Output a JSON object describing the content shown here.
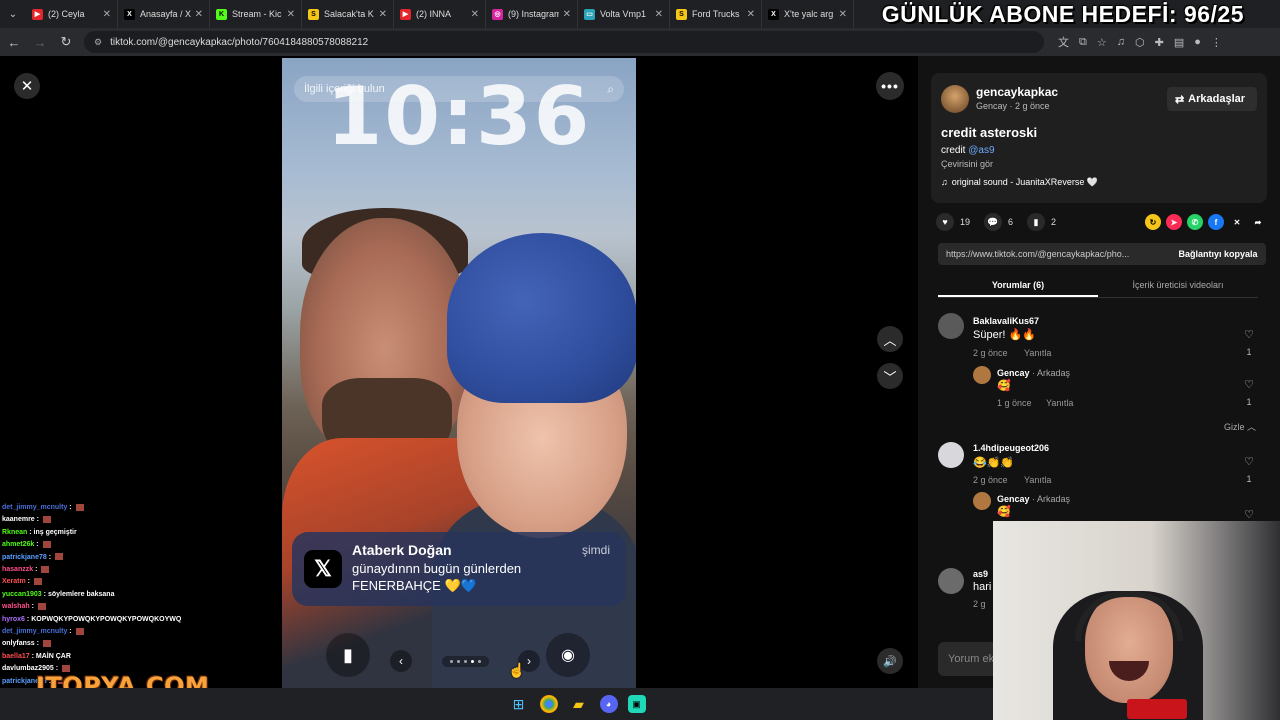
{
  "browser": {
    "tabs": [
      {
        "label": "(2) Ceyla",
        "favicon": "youtube-icon",
        "color": "#e5252a"
      },
      {
        "label": "Anasayfa / X",
        "favicon": "x-icon",
        "color": "#000000"
      },
      {
        "label": "Stream - Kic",
        "favicon": "kick-icon",
        "color": "#53fc18"
      },
      {
        "label": "Salacak'ta K",
        "favicon": "s-icon",
        "color": "#f5c518"
      },
      {
        "label": "(2) INNA",
        "favicon": "youtube-icon",
        "color": "#e5252a"
      },
      {
        "label": "(9) Instagram",
        "favicon": "instagram-icon",
        "color": "#d6249f"
      },
      {
        "label": "Volta Vmp1",
        "favicon": "volta-icon",
        "color": "#2aa4b8"
      },
      {
        "label": "Ford Trucks",
        "favicon": "s-icon",
        "color": "#f5c518"
      },
      {
        "label": "X'te yalc arg",
        "favicon": "x-icon",
        "color": "#000000"
      }
    ],
    "overlay_goal": "GÜNLÜK ABONE HEDEFİ: 96/25",
    "url": "tiktok.com/@gencaykapkac/photo/7604184880578088212"
  },
  "viewer": {
    "lockscreen": {
      "search_placeholder": "İlgili içeriği bulun",
      "time": "10:36",
      "notification": {
        "sender": "Ataberk Doğan",
        "time": "şimdi",
        "line1": "günaydınnn bugün günlerden",
        "line2": "FENERBAHÇE 💛💙"
      }
    },
    "pager": {
      "dots": 5,
      "active_index": 3
    }
  },
  "chat": [
    {
      "user": "det_jimmy_mcnulty",
      "msg": "",
      "color": "#4a6fd8"
    },
    {
      "user": "kaanemre",
      "msg": "",
      "color": "#ffffff"
    },
    {
      "user": "Rknean",
      "msg": "inş geçmiştir",
      "color": "#53fc18"
    },
    {
      "user": "ahmet26k",
      "msg": "",
      "color": "#53fc18"
    },
    {
      "user": "patrickjane78",
      "msg": "",
      "color": "#5aa0ff"
    },
    {
      "user": "hasanzzk",
      "msg": "",
      "color": "#ff4f8b"
    },
    {
      "user": "Xeratm",
      "msg": "",
      "color": "#ff4f4f"
    },
    {
      "user": "yuccan1903",
      "msg": "söylemlere baksana",
      "color": "#53fc18"
    },
    {
      "user": "walshah",
      "msg": "",
      "color": "#ff4f8b"
    },
    {
      "user": "hyrox6",
      "msg": "KOPWQKYPOWQKYPOWQKYPOWQKOYWQ",
      "color": "#b070ff"
    },
    {
      "user": "det_jimmy_mcnulty",
      "msg": "",
      "color": "#4a6fd8"
    },
    {
      "user": "onlyfanss",
      "msg": "",
      "color": "#ffffff"
    },
    {
      "user": "baella17",
      "msg": "MAİN ÇAR",
      "color": "#ff4f4f"
    },
    {
      "user": "davlumbaz2905",
      "msg": "",
      "color": "#ffffff"
    },
    {
      "user": "patrickjane78",
      "msg": "",
      "color": "#5aa0ff"
    }
  ],
  "watermark": "ITOPYA.COM",
  "panel": {
    "author": {
      "username": "gencaykapkac",
      "meta": "Gencay · 2 g önce",
      "friends_label": "Arkadaşlar",
      "title": "credit asteroski",
      "credit_prefix": "credit ",
      "credit_mention": "@as9",
      "translate": "Çevirisini gör",
      "sound": "original sound - JuanitaXReverse 🤍"
    },
    "stats": {
      "likes": "19",
      "comments": "6",
      "saves": "2"
    },
    "link_text": "https://www.tiktok.com/@gencaykapkac/pho...",
    "copy_label": "Bağlantıyı kopyala",
    "tabs": [
      {
        "label": "Yorumlar (6)",
        "active": true
      },
      {
        "label": "İçerik üreticisi videoları",
        "active": false
      }
    ],
    "comments": [
      {
        "user": "BaklavaliKus67",
        "text": "Süper! 🔥🔥",
        "meta": "2 g önce",
        "reply": "Yanıtla",
        "likes": "1"
      },
      {
        "user": "Gencay",
        "tag": " · Arkadaş",
        "text": "🥰",
        "meta": "1 g önce",
        "reply": "Yanıtla",
        "likes": "1"
      },
      {
        "hide": "Gizle"
      },
      {
        "user": "1.4hdipeugeot206",
        "text": "😂👏👏",
        "meta": "2 g önce",
        "reply": "Yanıtla",
        "likes": "1"
      },
      {
        "user": "Gencay",
        "tag": " · Arkadaş",
        "text": "🥰",
        "meta": "",
        "reply": "",
        "likes": ""
      },
      {
        "user": "as9",
        "text": "hari",
        "meta": "2 g",
        "reply": "",
        "likes": ""
      }
    ],
    "comment_placeholder": "Yorum ek"
  }
}
